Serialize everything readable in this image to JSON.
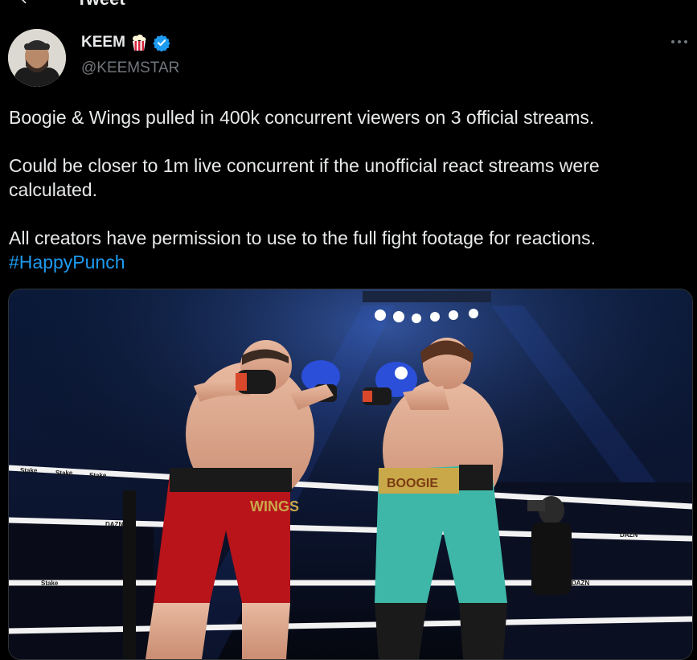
{
  "header": {
    "title": "Tweet",
    "back_icon": "arrow-left-icon"
  },
  "author": {
    "display_name": "KEEM",
    "emoji_icon": "popcorn-icon",
    "verified_icon": "verified-badge-icon",
    "handle": "@KEEMSTAR",
    "more_icon": "more-options-icon"
  },
  "tweet": {
    "line1": "Boogie & Wings pulled in 400k concurrent viewers on 3 official streams.",
    "line2": "Could be closer to 1m live concurrent if the unofficial react streams were calculated.",
    "line3": "All creators have permission to use to the full fight footage for reactions.",
    "hashtag": "#HappyPunch"
  },
  "media": {
    "description_icon": "boxing-photo",
    "trunks_left_text": "WINGS",
    "trunks_right_text": "BOOGIE",
    "sponsor_text": "Stake",
    "broadcaster_text": "DAZN"
  },
  "colors": {
    "background": "#000000",
    "text": "#e7e9ea",
    "secondary": "#71767b",
    "accent": "#1d9bf0"
  }
}
